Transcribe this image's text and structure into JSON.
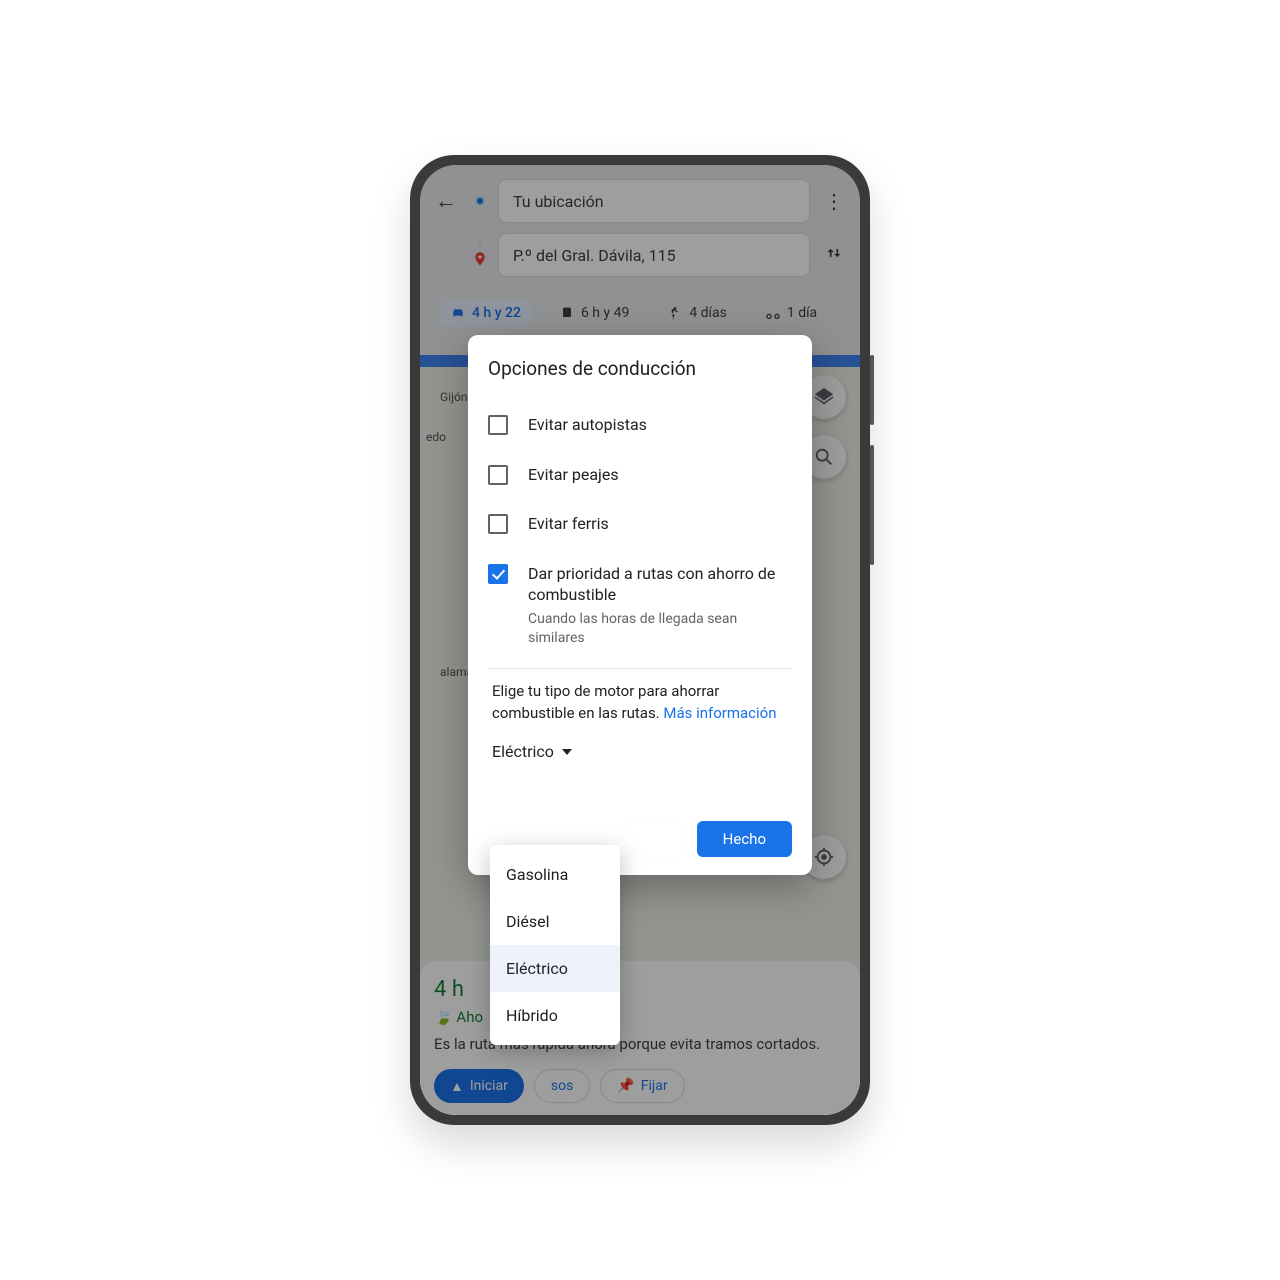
{
  "header": {
    "origin": "Tu ubicación",
    "destination": "P.º del Gral. Dávila, 115"
  },
  "modes": {
    "car": "4 h y 22",
    "transit": "6 h y 49",
    "walk": "4 días",
    "bike": "1 día"
  },
  "map_labels": {
    "l1": "Gijón",
    "l2": "edo",
    "l3": "alamanca"
  },
  "bottom": {
    "time": "4 h",
    "leaf": "  Aho",
    "desc": "Es la ruta más rápida ahora porque evita tramos cortados.",
    "start": "Iniciar",
    "steps": "sos",
    "pin": "Fijar"
  },
  "modal": {
    "title": "Opciones de conducción",
    "opt1": "Evitar autopistas",
    "opt2": "Evitar peajes",
    "opt3": "Evitar ferris",
    "opt4": "Dar prioridad a rutas con ahorro de combustible",
    "opt4_sub": "Cuando las horas de llegada sean similares",
    "engine_prompt": "Elige tu tipo de motor para ahorrar combustible en las rutas. ",
    "more_info": "Más información",
    "engine_selected": "Eléctrico",
    "done": "Hecho"
  },
  "dropdown": {
    "gasolina": "Gasolina",
    "diesel": "Diésel",
    "electrico": "Eléctrico",
    "hibrido": "Híbrido"
  }
}
